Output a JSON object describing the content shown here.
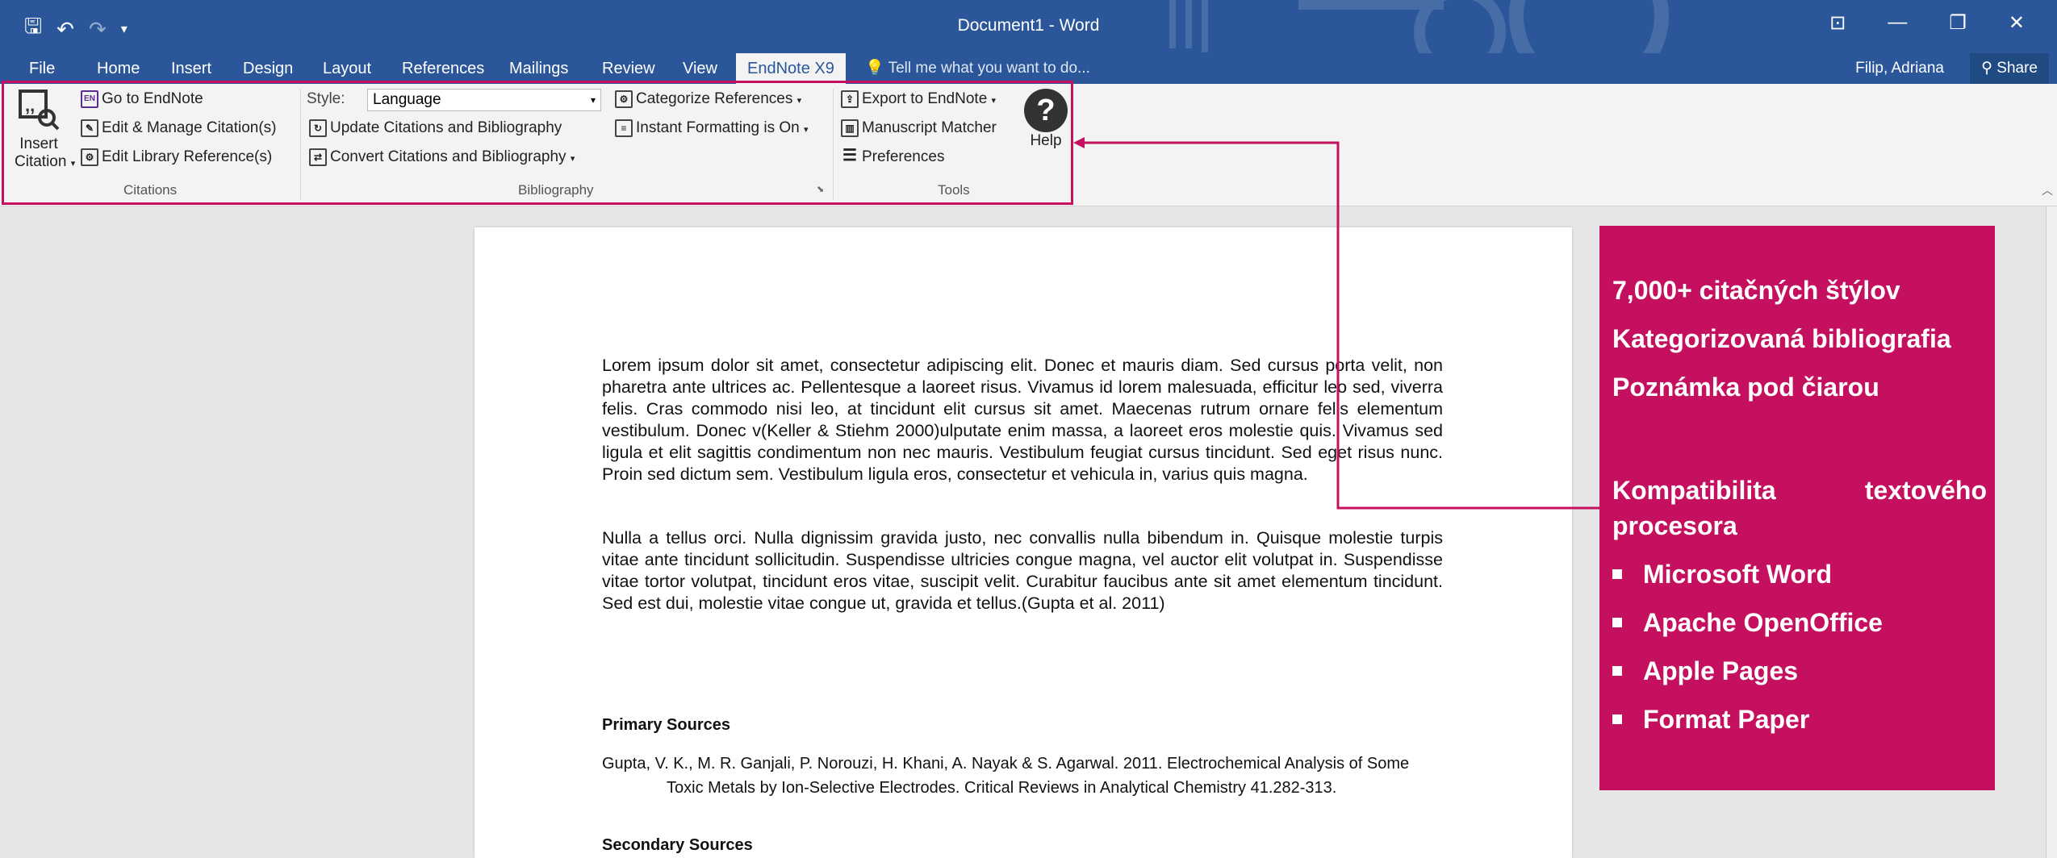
{
  "window": {
    "title": "Document1 - Word"
  },
  "qat": {
    "save": "🖫",
    "undo": "↶",
    "redo": "↷",
    "customize": "▾"
  },
  "winctl": {
    "restore_ribbon": "⊡",
    "minimize": "—",
    "maximize": "❐",
    "close": "✕"
  },
  "tabs": [
    "File",
    "Home",
    "Insert",
    "Design",
    "Layout",
    "References",
    "Mailings",
    "Review",
    "View",
    "EndNote X9"
  ],
  "tellme": "Tell me what you want to do...",
  "user": "Filip, Adriana",
  "share": "Share",
  "ribbon": {
    "insert_citation_line1": "Insert",
    "insert_citation_line2": "Citation",
    "go_to_endnote": "Go to EndNote",
    "edit_manage": "Edit & Manage Citation(s)",
    "edit_library": "Edit Library Reference(s)",
    "group_citations": "Citations",
    "style_label": "Style:",
    "style_value": "Language",
    "update_citations": "Update Citations and Bibliography",
    "convert_citations": "Convert Citations and Bibliography",
    "categorize": "Categorize References",
    "instant_formatting": "Instant Formatting is On",
    "group_bibliography": "Bibliography",
    "export": "Export to EndNote",
    "manuscript": "Manuscript Matcher",
    "preferences": "Preferences",
    "help": "Help",
    "group_tools": "Tools"
  },
  "document": {
    "para1": "Lorem ipsum dolor sit amet, consectetur adipiscing elit. Donec et mauris diam. Sed cursus porta velit, non pharetra ante ultrices ac. Pellentesque a laoreet risus. Vivamus id lorem malesuada, efficitur leo sed, viverra felis. Cras commodo nisi leo, at tincidunt elit cursus sit amet. Maecenas rutrum ornare felis elementum vestibulum. Donec v(Keller & Stiehm 2000)ulputate enim massa, a laoreet eros molestie quis. Vivamus sed ligula et elit sagittis condimentum non nec mauris. Vestibulum feugiat cursus tincidunt. Sed eget risus nunc. Proin sed dictum sem. Vestibulum ligula eros, consectetur et vehicula in, varius quis magna.",
    "para2": "Nulla a tellus orci. Nulla dignissim gravida justo, nec convallis nulla bibendum in. Quisque molestie turpis vitae ante tincidunt sollicitudin. Suspendisse ultricies congue magna, vel auctor elit volutpat in. Suspendisse vitae tortor volutpat, tincidunt eros vitae, suscipit velit. Curabitur faucibus ante sit amet elementum tincidunt. Sed est dui, molestie vitae congue ut, gravida et tellus.(Gupta et al. 2011)",
    "primary_heading": "Primary Sources",
    "primary_ref": "Gupta, V. K., M. R. Ganjali, P. Norouzi, H. Khani, A. Nayak & S. Agarwal. 2011. Electrochemical Analysis of Some Toxic Metals by Ion-Selective Electrodes. Critical Reviews in Analytical Chemistry 41.282-313.",
    "secondary_heading": "Secondary Sources"
  },
  "panel": {
    "line1": "7,000+ citačných štýlov",
    "line2": "Kategorizovaná bibliografia",
    "line3": "Poznámka pod čiarou",
    "compat1": "Kompatibilita",
    "compat2": "textového",
    "compat3": "procesora",
    "items": [
      "Microsoft Word",
      "Apache OpenOffice",
      "Apple Pages",
      "Format Paper"
    ]
  },
  "colors": {
    "word_blue": "#2b579a",
    "accent": "#c4105f"
  }
}
